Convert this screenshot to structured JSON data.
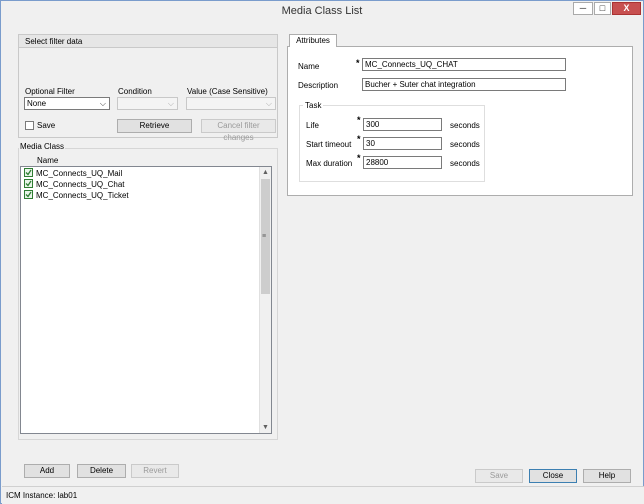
{
  "window": {
    "title": "Media Class List",
    "minimize_glyph": "─",
    "maximize_glyph": "□",
    "close_glyph": "X"
  },
  "filter": {
    "section_title": "Select filter data",
    "optional_filter_label": "Optional Filter",
    "optional_filter_value": "None",
    "condition_label": "Condition",
    "condition_value": "",
    "value_label": "Value (Case Sensitive)",
    "value_value": "",
    "save_label": "Save",
    "save_checked": false,
    "retrieve_label": "Retrieve",
    "cancel_label": "Cancel filter changes"
  },
  "media_class": {
    "section_title": "Media Class",
    "column_name": "Name",
    "items": [
      {
        "label": "MC_Connects_UQ_Mail"
      },
      {
        "label": "MC_Connects_UQ_Chat"
      },
      {
        "label": "MC_Connects_UQ_Ticket"
      }
    ],
    "add_label": "Add",
    "delete_label": "Delete",
    "revert_label": "Revert"
  },
  "attributes": {
    "tab_label": "Attributes",
    "name_label": "Name",
    "name_value": "MC_Connects_UQ_CHAT",
    "description_label": "Description",
    "description_value": "Bucher + Suter chat integration",
    "required_marker": "*",
    "task": {
      "group_title": "Task",
      "life_label": "Life",
      "life_value": "300",
      "start_timeout_label": "Start timeout",
      "start_timeout_value": "30",
      "max_duration_label": "Max duration",
      "max_duration_value": "28800",
      "unit_label": "seconds"
    }
  },
  "footer": {
    "save_label": "Save",
    "close_label": "Close",
    "help_label": "Help"
  },
  "status": {
    "text": "ICM Instance: lab01"
  },
  "colors": {
    "close_button": "#c75050",
    "check_green": "#2e7d32",
    "window_border": "#7a9ccc"
  }
}
